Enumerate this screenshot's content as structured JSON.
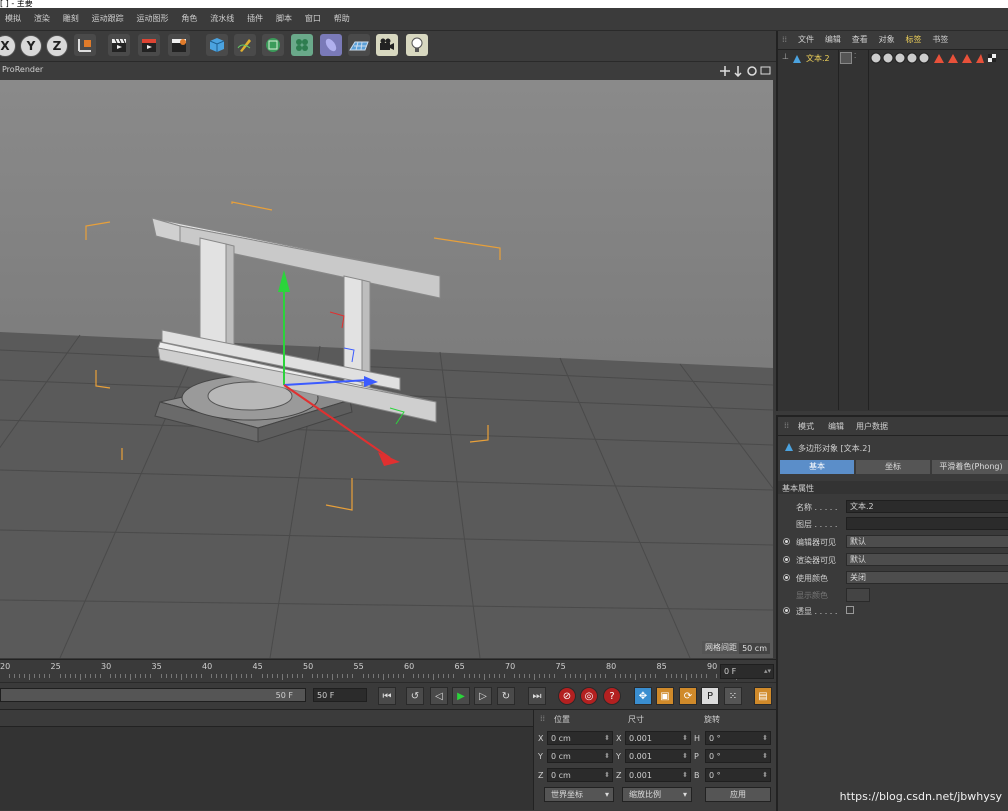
{
  "titlebar": {
    "text": "[ ] - 主要"
  },
  "menu": {
    "items": [
      "模拟",
      "渲染",
      "雕刻",
      "运动跟踪",
      "运动图形",
      "角色",
      "流水线",
      "插件",
      "脚本",
      "窗口",
      "帮助"
    ]
  },
  "toolbar": {
    "axis_x": "X",
    "axis_y": "Y",
    "axis_z": "Z"
  },
  "viewport": {
    "title": "ProRender",
    "grid_label": "网格间距",
    "grid_value": "50 cm"
  },
  "timeline": {
    "ticks": [
      "20",
      "25",
      "30",
      "35",
      "40",
      "45",
      "50",
      "55",
      "60",
      "65",
      "70",
      "75",
      "80",
      "85",
      "90"
    ],
    "current_frame": "0 F"
  },
  "transport": {
    "end_slider": "50 F",
    "end_field": "50 F"
  },
  "coords": {
    "position_label": "位置",
    "size_label": "尺寸",
    "rotation_label": "旋转",
    "rows": [
      {
        "pl": "X",
        "pv": "0 cm",
        "sl": "X",
        "sv": "0.001",
        "rl": "H",
        "rv": "0 °"
      },
      {
        "pl": "Y",
        "pv": "0 cm",
        "sl": "Y",
        "sv": "0.001",
        "rl": "P",
        "rv": "0 °"
      },
      {
        "pl": "Z",
        "pv": "0 cm",
        "sl": "Z",
        "sv": "0.001",
        "rl": "B",
        "rv": "0 °"
      }
    ],
    "mode": "世界坐标",
    "scale": "缩放比例",
    "apply": "应用"
  },
  "objects": {
    "tabs": [
      "文件",
      "编辑",
      "查看",
      "对象",
      "标签",
      "书签"
    ],
    "active_tab": "标签",
    "item": "文本.2"
  },
  "attributes": {
    "tabs": [
      "模式",
      "编辑",
      "用户数据"
    ],
    "object_title": "多边形对象 [文本.2]",
    "subtabs": [
      "基本",
      "坐标",
      "平滑着色(Phong)"
    ],
    "section": "基本属性",
    "name_label": "名称 . . . . .",
    "name_value": "文本.2",
    "layer_label": "图层 . . . . .",
    "editor_label": "编辑器可见",
    "editor_value": "默认",
    "render_label": "渲染器可见",
    "render_value": "默认",
    "color_label": "使用颜色",
    "color_value": "关闭",
    "display_label": "显示颜色",
    "xray_label": "透显 . . . . ."
  },
  "watermark": "https://blog.csdn.net/jbwhysy",
  "colors": {
    "accent": "#5b8ec9",
    "bg": "#3a3a3a",
    "viewport": "#6a6a6a",
    "tag_active": "#f0d25a"
  }
}
